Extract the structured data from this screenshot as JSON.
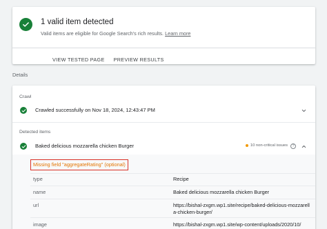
{
  "summary": {
    "title": "1 valid item detected",
    "subtitle": "Valid items are eligible for Google Search's rich results.",
    "learn_more": "Learn more",
    "actions": [
      "VIEW TESTED PAGE",
      "PREVIEW RESULTS"
    ]
  },
  "details_label": "Details",
  "crawl": {
    "heading": "Crawl",
    "status": "Crawled successfully on Nov 18, 2024, 12:43:47 PM"
  },
  "detected": {
    "heading": "Detected items",
    "item_name": "Baked delicious mozzarella chicken Burger",
    "issues": "10 non-critical issues",
    "missing_field": "Missing field \"aggregateRating\" (optional)",
    "fields": [
      {
        "key": "type",
        "value": "Recipe"
      },
      {
        "key": "name",
        "value": "Baked delicious mozzarella chicken Burger"
      },
      {
        "key": "url",
        "value": "https://bishal-zxgm.wp1.site/recipe/baked-delicious-mozzarella-chicken-burger/"
      },
      {
        "key": "image",
        "value": "https://bishal-zxgm.wp1.site/wp-content/uploads/2020/10/"
      }
    ]
  },
  "colors": {
    "success": "#188038",
    "warning": "#f29900",
    "error_outline": "#d93025",
    "warning_text": "#e37400"
  },
  "icons": [
    "check-circle-icon",
    "chevron-down-icon",
    "chevron-up-icon",
    "help-icon"
  ]
}
